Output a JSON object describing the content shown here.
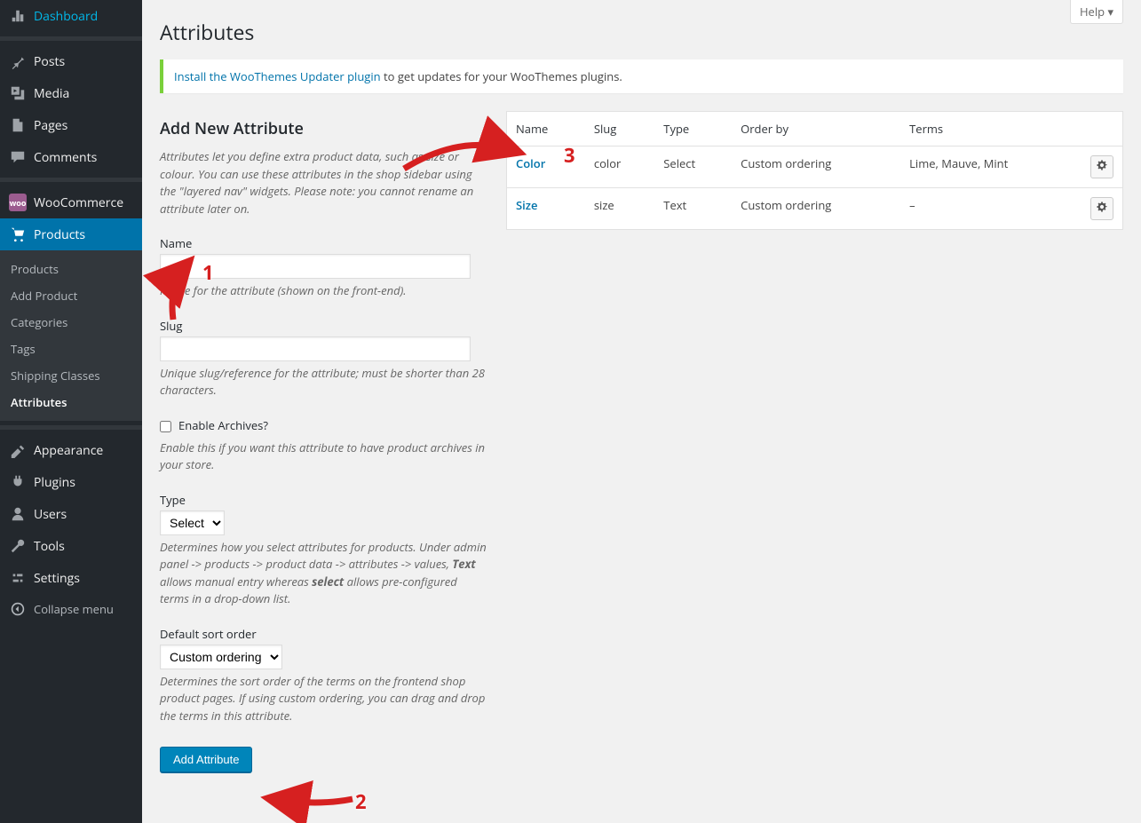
{
  "help_tab": "Help ▾",
  "page_title": "Attributes",
  "notice": {
    "link": "Install the WooThemes Updater plugin",
    "text": " to get updates for your WooThemes plugins."
  },
  "sidebar": {
    "dashboard": "Dashboard",
    "posts": "Posts",
    "media": "Media",
    "pages": "Pages",
    "comments": "Comments",
    "woocommerce": "WooCommerce",
    "products": "Products",
    "products_sub": {
      "products": "Products",
      "add_product": "Add Product",
      "categories": "Categories",
      "tags": "Tags",
      "shipping_classes": "Shipping Classes",
      "attributes": "Attributes"
    },
    "appearance": "Appearance",
    "plugins": "Plugins",
    "users": "Users",
    "tools": "Tools",
    "settings": "Settings",
    "collapse": "Collapse menu"
  },
  "form": {
    "title": "Add New Attribute",
    "intro": "Attributes let you define extra product data, such as size or colour. You can use these attributes in the shop sidebar using the \"layered nav\" widgets. Please note: you cannot rename an attribute later on.",
    "name_label": "Name",
    "name_help": "Name for the attribute (shown on the front-end).",
    "slug_label": "Slug",
    "slug_help": "Unique slug/reference for the attribute; must be shorter than 28 characters.",
    "archives_label": "Enable Archives?",
    "archives_help": "Enable this if you want this attribute to have product archives in your store.",
    "type_label": "Type",
    "type_select": "Select",
    "type_help_pre": "Determines how you select attributes for products. Under admin panel -> products -> product data -> attributes -> values, ",
    "type_help_b1": "Text",
    "type_help_mid": " allows manual entry whereas ",
    "type_help_b2": "select",
    "type_help_post": " allows pre-configured terms in a drop-down list.",
    "sort_label": "Default sort order",
    "sort_select": "Custom ordering",
    "sort_help": "Determines the sort order of the terms on the frontend shop product pages. If using custom ordering, you can drag and drop the terms in this attribute.",
    "submit": "Add Attribute"
  },
  "table": {
    "headers": {
      "name": "Name",
      "slug": "Slug",
      "type": "Type",
      "orderby": "Order by",
      "terms": "Terms"
    },
    "rows": [
      {
        "name": "Color",
        "slug": "color",
        "type": "Select",
        "orderby": "Custom ordering",
        "terms": "Lime, Mauve, Mint"
      },
      {
        "name": "Size",
        "slug": "size",
        "type": "Text",
        "orderby": "Custom ordering",
        "terms": "–"
      }
    ]
  },
  "annotations": {
    "n1": "1",
    "n2": "2",
    "n3": "3"
  }
}
